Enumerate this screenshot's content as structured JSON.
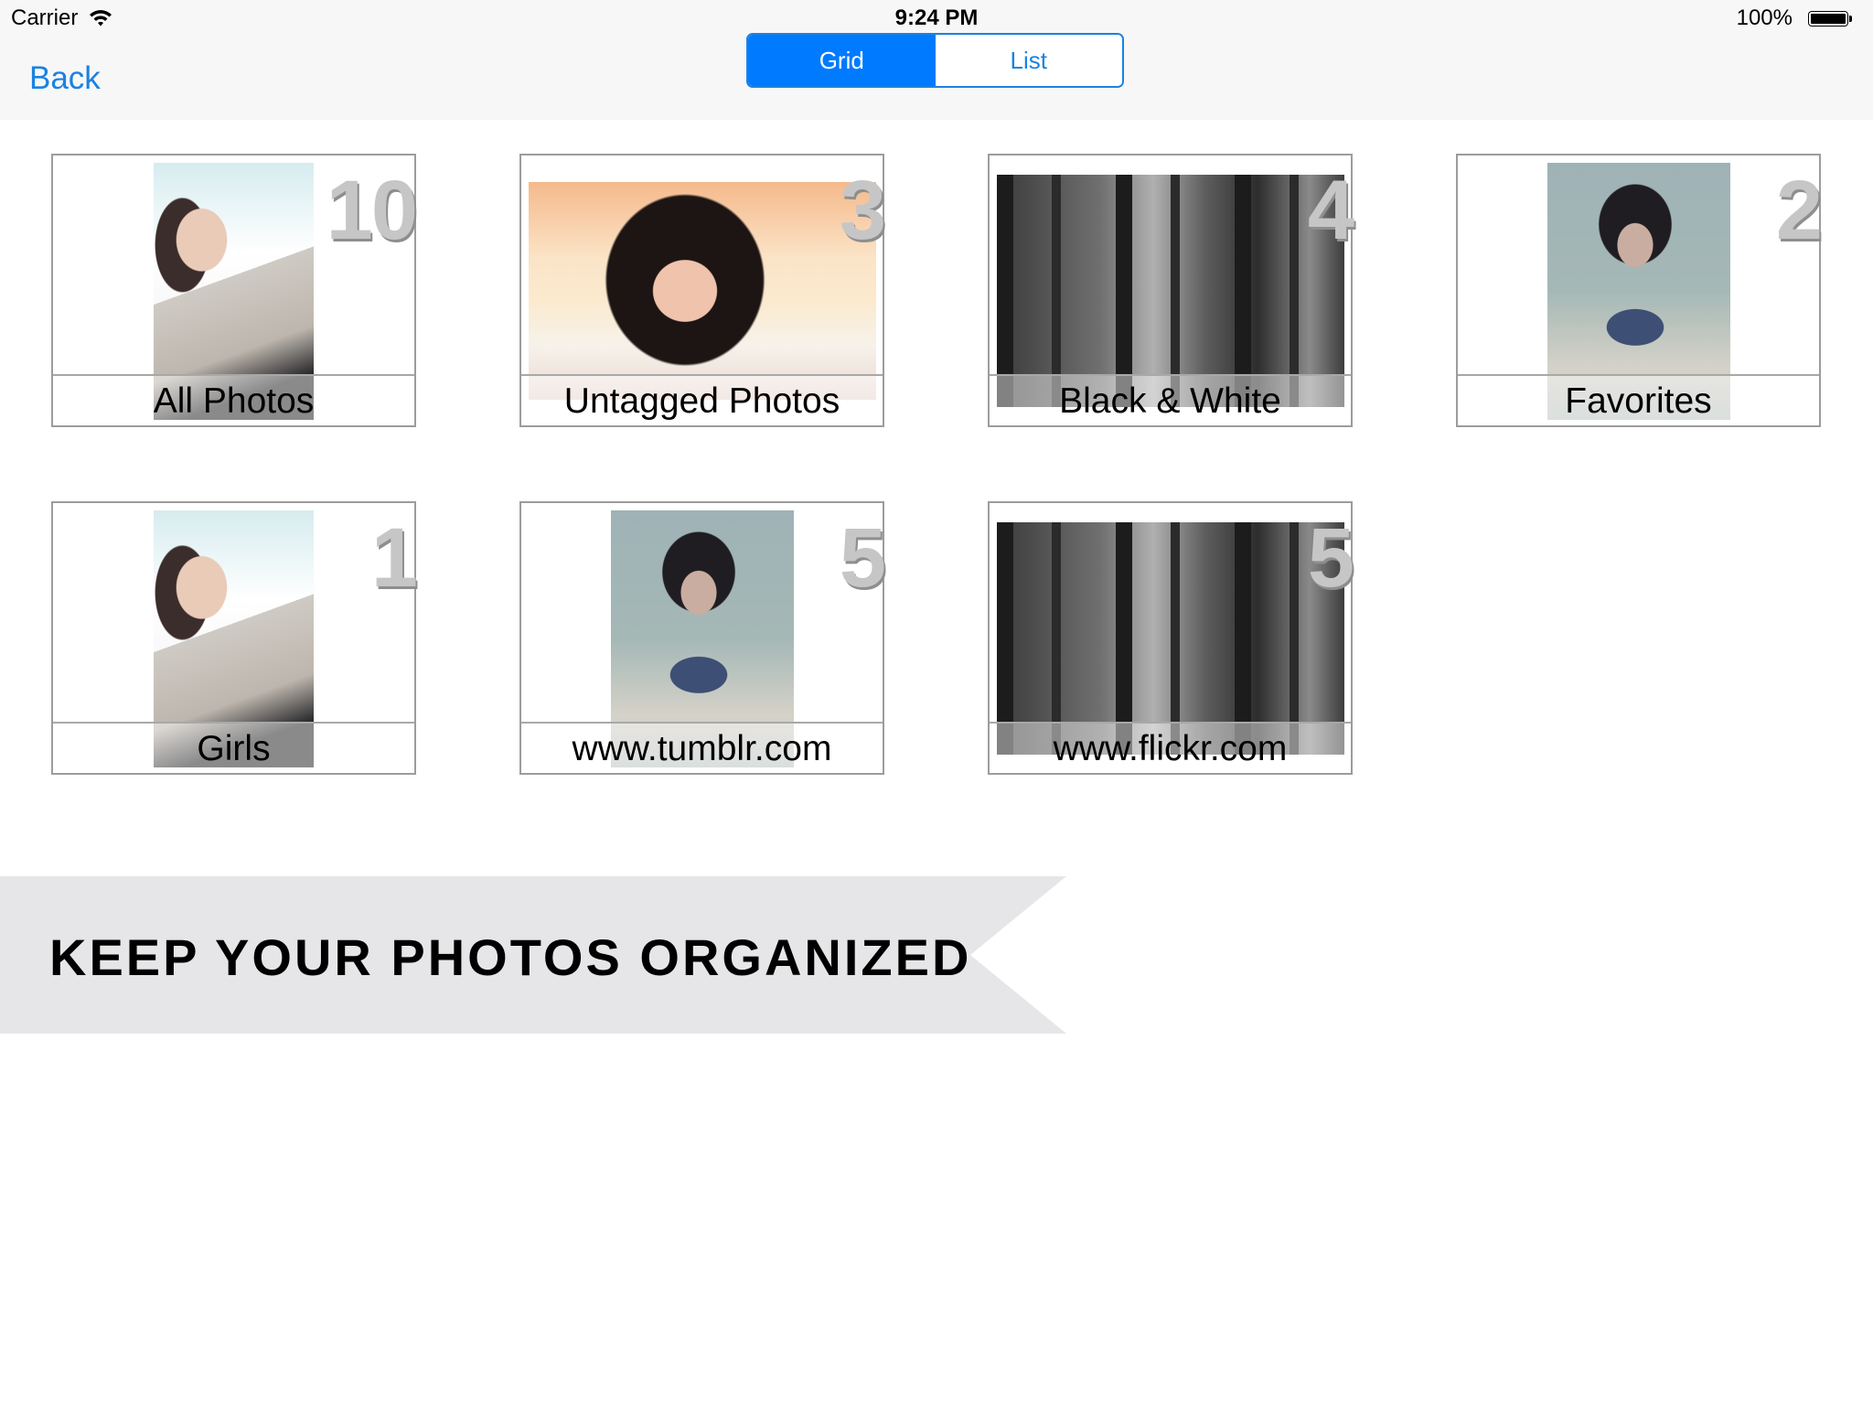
{
  "status_bar": {
    "carrier": "Carrier",
    "time": "9:24 PM",
    "battery_percent": "100%",
    "battery_level": 1.0,
    "wifi_icon": "wifi-icon",
    "battery_icon": "battery-icon"
  },
  "navbar": {
    "back_label": "Back",
    "segments": [
      {
        "label": "Grid",
        "selected": true
      },
      {
        "label": "List",
        "selected": false
      }
    ]
  },
  "colors": {
    "accent": "#007aff",
    "link": "#1a82e2",
    "banner_bg": "#e6e6e8",
    "count_text": "#c6c6c6"
  },
  "albums": [
    {
      "title": "All Photos",
      "count": "10",
      "thumbnail": "photo-girl-white-shirt"
    },
    {
      "title": "Untagged Photos",
      "count": "3",
      "thumbnail": "photo-girl-sunset"
    },
    {
      "title": "Black & White",
      "count": "4",
      "thumbnail": "photo-forest-bw"
    },
    {
      "title": "Favorites",
      "count": "2",
      "thumbnail": "photo-girl-denim"
    },
    {
      "title": "Girls",
      "count": "1",
      "thumbnail": "photo-girl-white-shirt"
    },
    {
      "title": "www.tumblr.com",
      "count": "5",
      "thumbnail": "photo-girl-denim"
    },
    {
      "title": "www.flickr.com",
      "count": "5",
      "thumbnail": "photo-forest-bw"
    }
  ],
  "banner": {
    "text": "KEEP YOUR PHOTOS ORGANIZED"
  }
}
